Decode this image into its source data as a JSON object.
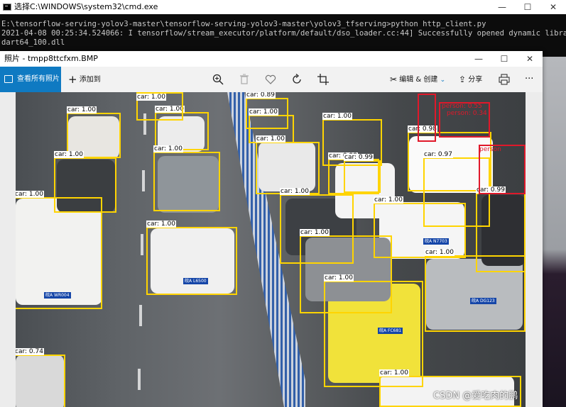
{
  "cmd": {
    "title": "选择C:\\WINDOWS\\system32\\cmd.exe",
    "lines": [
      "E:\\tensorflow-serving-yolov3-master\\tensorflow-serving-yolov3-master\\yolov3_tfserving>python http_client.py",
      "2021-04-08 00:25:34.524066: I tensorflow/stream_executor/platform/default/dso_loader.cc:44] Successfully opened dynamic library cu",
      "dart64_100.dll"
    ],
    "minimize": "—",
    "maximize": "☐",
    "close": "✕"
  },
  "photos": {
    "title": "照片 - tmpp8ttcfxm.BMP",
    "minimize": "—",
    "maximize": "☐",
    "close": "✕",
    "toolbar": {
      "view_all": "查看所有照片",
      "add_to": "添加到",
      "edit_create": "编辑 & 创建",
      "share": "分享",
      "more": "···"
    }
  },
  "detections": [
    {
      "label": "car: 1.00"
    },
    {
      "label": "car: 1.00"
    },
    {
      "label": "car: 1.00"
    },
    {
      "label": "car: 1.00"
    },
    {
      "label": "car: 1.00"
    },
    {
      "label": "car: 1.00"
    },
    {
      "label": "car: 1.00"
    },
    {
      "label": "car: 0.74"
    },
    {
      "label": "car: 0.89"
    },
    {
      "label": "car: 1.00"
    },
    {
      "label": "car: 1.00"
    },
    {
      "label": "car: 1.00"
    },
    {
      "label": "car: 0.99"
    },
    {
      "label": "car: 1.00"
    },
    {
      "label": "car: 0.99"
    },
    {
      "label": "car: 1.00"
    },
    {
      "label": "car: 0.98"
    },
    {
      "label": "car: 0.97"
    },
    {
      "label": "car: 1.00"
    },
    {
      "label": "car: 1.00"
    },
    {
      "label": "car: 1.00"
    },
    {
      "label": "car: 0.99"
    },
    {
      "label": "car: 1.00"
    },
    {
      "label": "person: 0.55"
    },
    {
      "label": "person: 0.34"
    },
    {
      "label": "person"
    }
  ],
  "plates": [
    "皖A WR004",
    "皖A L6500",
    "皖A FC681",
    "皖A DG123",
    "皖A N7703"
  ],
  "watermark": "CSDN @爱吃肉的鹏",
  "colors": {
    "box": "#ffd400",
    "person_box": "#e0182a",
    "accent": "#0f7ac2"
  }
}
